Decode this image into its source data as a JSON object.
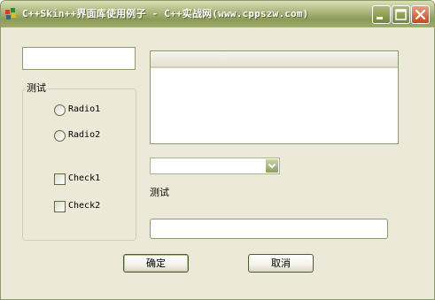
{
  "window": {
    "title": "C++Skin++界面库使用例子 - C++实战网(www.cppszw.com)",
    "accent_color": "#8c9b55",
    "close_color": "#c4491f"
  },
  "titlebar_buttons": [
    "minimize-icon",
    "maximize-icon",
    "close-icon"
  ],
  "edit_top": {
    "value": ""
  },
  "group": {
    "label": "测试",
    "radios": [
      {
        "label": "Radio1",
        "checked": false
      },
      {
        "label": "Radio2",
        "checked": false
      }
    ],
    "checks": [
      {
        "label": "Check1",
        "checked": false
      },
      {
        "label": "Check2",
        "checked": false
      }
    ]
  },
  "listbox": {
    "items": []
  },
  "combo": {
    "selected": ""
  },
  "static_label": "测试",
  "edit_bottom": {
    "value": ""
  },
  "buttons": {
    "ok": "确定",
    "cancel": "取消"
  }
}
